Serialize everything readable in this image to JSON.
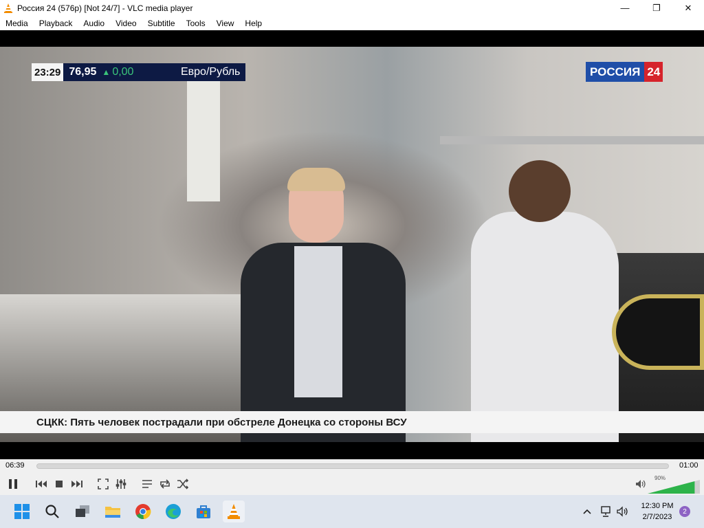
{
  "window": {
    "title": "Россия 24 (576p) [Not 24/7] - VLC media player",
    "controls": {
      "minimize": "—",
      "maximize": "❐",
      "close": "✕"
    }
  },
  "menu": [
    "Media",
    "Playback",
    "Audio",
    "Video",
    "Subtitle",
    "Tools",
    "View",
    "Help"
  ],
  "overlay": {
    "time": "23:29",
    "rate_value": "76,95",
    "rate_change": "0,00",
    "rate_pair": "Евро/Рубль",
    "channel_name": "РОССИЯ",
    "channel_num": "24",
    "news_ticker": "СЦКК: Пять человек пострадали при обстреле Донецка со стороны ВСУ"
  },
  "playback": {
    "elapsed": "06:39",
    "duration": "01:00",
    "volume_label": "90%",
    "volume_level": 0.9
  },
  "icons": {
    "app": "vlc-cone-icon",
    "pause": "pause-icon",
    "prev": "previous-icon",
    "stop": "stop-icon",
    "next": "next-icon",
    "fullscreen": "fullscreen-icon",
    "extended": "extended-settings-icon",
    "playlist": "playlist-icon",
    "loop": "loop-icon",
    "shuffle": "shuffle-icon",
    "speaker": "speaker-icon"
  },
  "taskbar": {
    "clock_time": "12:30 PM",
    "clock_date": "2/7/2023",
    "notification_count": "2"
  },
  "colors": {
    "vlc_orange": "#f28c00",
    "volume_green": "#2db34a",
    "russia24_blue": "#1f4ea8",
    "russia24_red": "#d6232b"
  }
}
